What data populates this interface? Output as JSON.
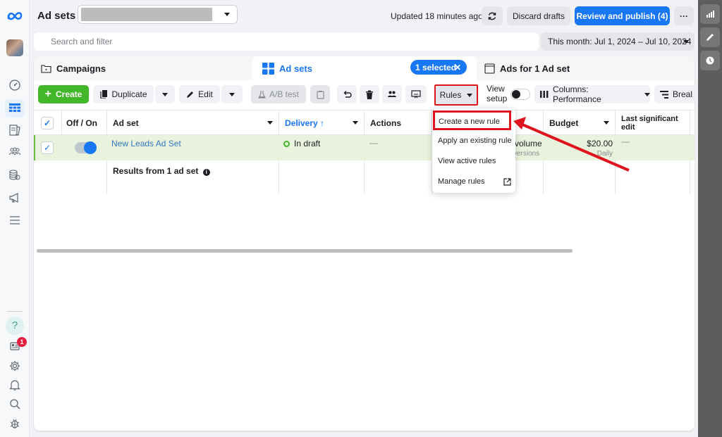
{
  "header": {
    "title": "Ad sets",
    "updated_text": "Updated 18 minutes ago",
    "discard_label": "Discard drafts",
    "publish_label": "Review and publish (4)",
    "more_label": "···",
    "search_placeholder": "Search and filter",
    "date_range": "This month: Jul 1, 2024 – Jul 10, 2024"
  },
  "left_nav": {
    "items": [
      "account-overview",
      "ads-manager",
      "campaign-planner",
      "audiences",
      "billing",
      "advertise"
    ],
    "notification_count": "1"
  },
  "right_strip": {
    "items": [
      "charts",
      "edit",
      "history"
    ]
  },
  "tabs": {
    "campaigns": "Campaigns",
    "adsets": "Ad sets",
    "ads": "Ads for 1 Ad set",
    "selected_pill": "1 selected",
    "selected_clear": "✕"
  },
  "toolbar": {
    "create": "Create",
    "duplicate": "Duplicate",
    "edit": "Edit",
    "ab_test": "A/B test",
    "rules": "Rules",
    "view_setup": "View setup",
    "columns": "Columns: Performance",
    "breakdown": "Breal"
  },
  "table": {
    "columns": {
      "off_on": "Off / On",
      "ad_set": "Ad set",
      "delivery": "Delivery ↑",
      "actions": "Actions",
      "budget": "Budget",
      "last_edit": "Last significant edit"
    },
    "rows": [
      {
        "name": "New Leads Ad Set",
        "delivery": "In draft",
        "actions": "—",
        "bid_strategy": "volume",
        "bid_strategy_sub": "versions",
        "budget": "$20.00",
        "budget_type": "Daily",
        "last_edit": "—",
        "selected": true,
        "on": true
      }
    ],
    "summary": "Results from 1 ad set"
  },
  "rules_menu": {
    "items": [
      "Create a new rule",
      "Apply an existing rule",
      "View active rules",
      "Manage rules"
    ]
  },
  "colors": {
    "accent": "#1877f2",
    "create_green": "#42b72a",
    "highlight_red": "#e0141e"
  }
}
